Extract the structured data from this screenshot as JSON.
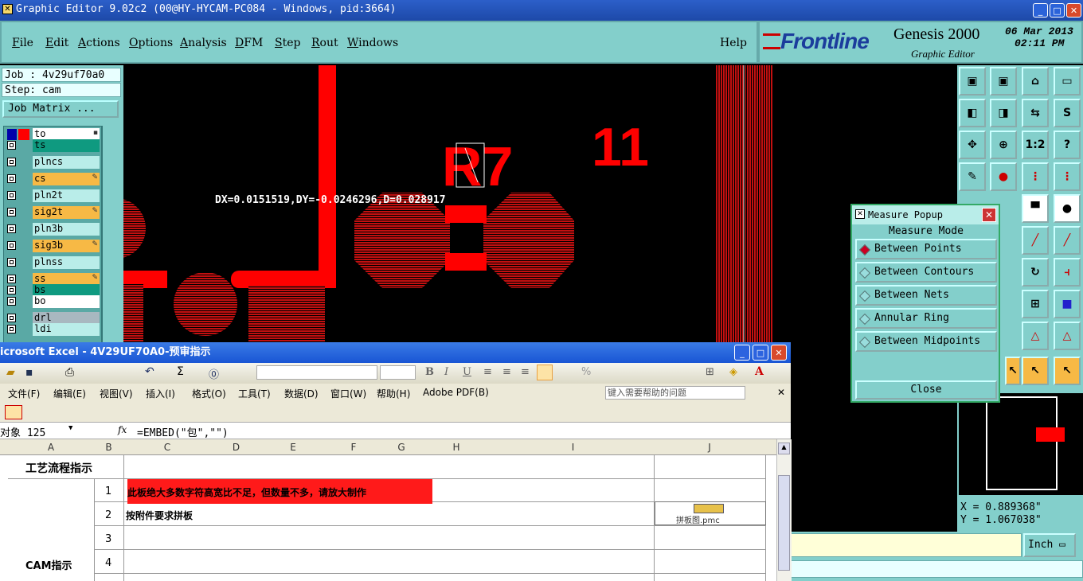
{
  "app": {
    "title": "Graphic Editor 9.02c2 (00@HY-HYCAM-PC084 - Windows, pid:3664)",
    "window_controls": [
      "_",
      "□",
      "✕"
    ]
  },
  "menubar": {
    "items": [
      "File",
      "Edit",
      "Actions",
      "Options",
      "Analysis",
      "DFM",
      "Step",
      "Rout",
      "Windows"
    ],
    "help": "Help"
  },
  "brand": {
    "logo": "Frontline",
    "product": "Genesis 2000",
    "subtitle": "Graphic Editor",
    "date": "06 Mar 2013",
    "time": "02:11 PM"
  },
  "job": {
    "job_label": "Job : 4v29uf70a0",
    "step_label": "Step: cam",
    "matrix_button": "Job Matrix ..."
  },
  "layers": [
    {
      "name": "to",
      "color": "#ffffff",
      "flag": "▪"
    },
    {
      "name": "ts",
      "color": "#0f9a80",
      "flag": ""
    },
    {
      "name": "plncs",
      "color": "#b9ede9",
      "flag": ""
    },
    {
      "name": "cs",
      "color": "#f7b945",
      "flag": "✎"
    },
    {
      "name": "pln2t",
      "color": "#b9ede9",
      "flag": ""
    },
    {
      "name": "sig2t",
      "color": "#f7b945",
      "flag": "✎"
    },
    {
      "name": "pln3b",
      "color": "#b9ede9",
      "flag": ""
    },
    {
      "name": "sig3b",
      "color": "#f7b945",
      "flag": "✎"
    },
    {
      "name": "plnss",
      "color": "#b9ede9",
      "flag": ""
    },
    {
      "name": "ss",
      "color": "#f7b945",
      "flag": "✎"
    },
    {
      "name": "bs",
      "color": "#0f9a80",
      "flag": ""
    },
    {
      "name": "bo",
      "color": "#ffffff",
      "flag": ""
    },
    {
      "name": "drl",
      "color": "#a8b8c0",
      "flag": ""
    },
    {
      "name": "ldi",
      "color": "#b9ede9",
      "flag": ""
    }
  ],
  "canvas": {
    "designator": "R7",
    "designator2": "11",
    "measure_readout": "DX=0.0151519,DY=-0.0246296,D=0.028917",
    "trace_color": "#ff0000"
  },
  "measure_popup": {
    "title": "Measure Popup",
    "section": "Measure Mode",
    "options": [
      "Between Points",
      "Between Contours",
      "Between Nets",
      "Annular Ring",
      "Between Midpoints"
    ],
    "selected": "Between Points",
    "close": "Close"
  },
  "toolbar_right": {
    "labels": [
      "1:2",
      "?"
    ]
  },
  "coords": {
    "x": "X = 0.889368\"",
    "y": "Y = 1.067038\""
  },
  "units": "Inch",
  "excel": {
    "title": "icrosoft Excel - 4V29UF70A0-预审指示",
    "menu": [
      "文件(F)",
      "编辑(E)",
      "视图(V)",
      "插入(I)",
      "格式(O)",
      "工具(T)",
      "数据(D)",
      "窗口(W)",
      "帮助(H)",
      "Adobe PDF(B)"
    ],
    "help_box": "键入需要帮助的问题",
    "name_box": "对象 125",
    "fx": "fx",
    "formula": "=EMBED(\"包\",\"\")",
    "columns": [
      "A",
      "B",
      "C",
      "D",
      "E",
      "F",
      "G",
      "H",
      "I",
      "J"
    ],
    "rows": [
      {
        "a": "工艺流程指示",
        "b": "",
        "c": ""
      },
      {
        "a": "",
        "b": "1",
        "c": "此板绝大多数字符高宽比不足，但数量不多，请放大制作"
      },
      {
        "a": "",
        "b": "2",
        "c": "按附件要求拼板"
      },
      {
        "a": "",
        "b": "3",
        "c": ""
      },
      {
        "a": "CAM指示",
        "b": "4",
        "c": ""
      }
    ],
    "embedded_caption": "拼板图.pmc"
  }
}
